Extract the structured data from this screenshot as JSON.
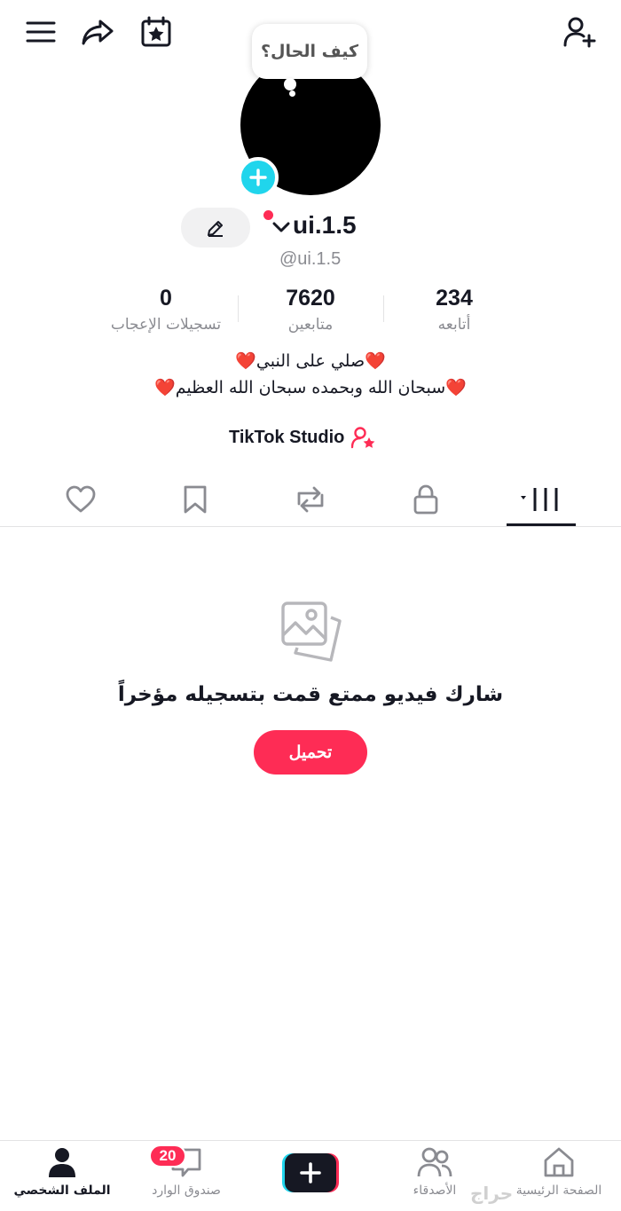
{
  "top_bar": {
    "icons": [
      "menu-icon",
      "share-icon",
      "calendar-star-icon",
      "add-friend-icon"
    ]
  },
  "profile": {
    "bubble_text": "كيف الحال؟",
    "display_name": "ui.1.5",
    "handle": "@ui.1.5",
    "stats": {
      "likes": {
        "value": "0",
        "label": "تسجيلات الإعجاب"
      },
      "followers": {
        "value": "7620",
        "label": "متابعين"
      },
      "following": {
        "value": "234",
        "label": "أتابعه"
      }
    },
    "bio_line1": "❤️صلي على النبي❤️",
    "bio_line2": "❤️سبحان الله وبحمده سبحان الله العظيم❤️",
    "studio_label": "TikTok Studio"
  },
  "tabs": {
    "icons": [
      "liked-icon",
      "favorites-icon",
      "reposts-icon",
      "private-icon",
      "videos-grid-icon"
    ],
    "active": "videos-grid-icon"
  },
  "empty_state": {
    "title": "شارك فيديو ممتع قمت بتسجيله مؤخراً",
    "button_label": "تحميل"
  },
  "bottom_nav": {
    "profile_label": "الملف الشخصي",
    "inbox_label": "صندوق الوارد",
    "inbox_badge": "20",
    "friends_label": "الأصدقاء",
    "home_label": "الصفحة الرئيسية",
    "watermark": "حراج"
  },
  "colors": {
    "accent": "#fe2c55",
    "cyan": "#20d5ec",
    "text": "#161823",
    "muted": "#8a8b91"
  }
}
